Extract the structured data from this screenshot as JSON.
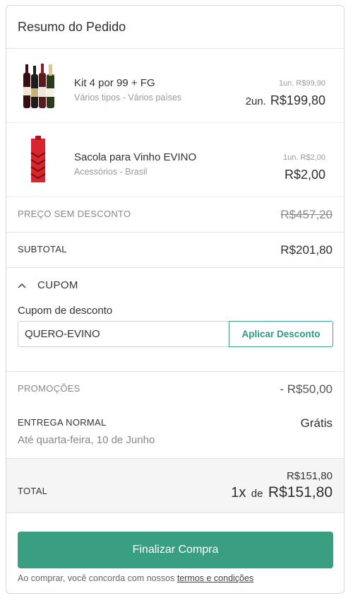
{
  "header": {
    "title": "Resumo do Pedido"
  },
  "items": [
    {
      "name": "Kit 4 por 99 + FG",
      "subtitle": "Vários tipos - Vários países",
      "unit_price": "1un. R$99,90",
      "qty": "2un.",
      "total": "R$199,80",
      "image": "wine-bottles-kit"
    },
    {
      "name": "Sacola para Vinho EVINO",
      "subtitle": "Acessórios - Brasil",
      "unit_price": "1un. R$2,00",
      "qty": "",
      "total": "R$2,00",
      "image": "red-wine-bag"
    }
  ],
  "price_no_discount": {
    "label": "PREÇO SEM DESCONTO",
    "value": "R$457,20"
  },
  "subtotal": {
    "label": "SUBTOTAL",
    "value": "R$201,80"
  },
  "coupon": {
    "toggle_label": "CUPOM",
    "field_label": "Cupom de desconto",
    "value": "QUERO-EVINO",
    "apply_label": "Aplicar Desconto"
  },
  "promotions": {
    "label": "PROMOÇÕES",
    "value": "- R$50,00"
  },
  "delivery": {
    "label": "ENTREGA NORMAL",
    "value": "Grátis",
    "estimate": "Até quarta-feira, 10 de Junho"
  },
  "total": {
    "label": "TOTAL",
    "full_value": "R$151,80",
    "installments": "1x",
    "de": "de",
    "installment_value": "R$151,80"
  },
  "checkout_button": "Finalizar Compra",
  "footer": {
    "text": "Ao comprar, você concorda com nossos",
    "link": "termos e condições"
  },
  "colors": {
    "accent": "#3a9f82",
    "bag_red": "#d9262e"
  }
}
